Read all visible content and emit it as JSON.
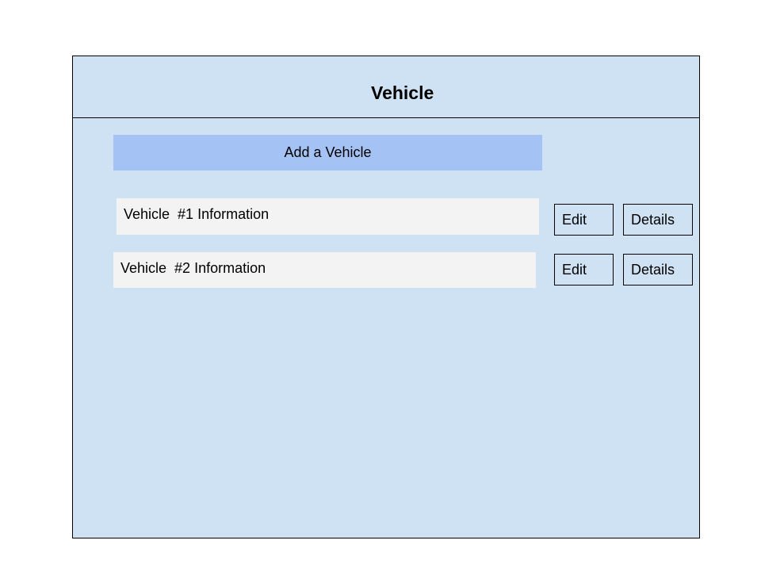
{
  "page": {
    "title": "Vehicle",
    "add_button_label": "Add a Vehicle"
  },
  "vehicles": [
    {
      "info": "Vehicle  #1 Information",
      "edit_label": "Edit",
      "details_label": "Details"
    },
    {
      "info": "Vehicle  #2 Information",
      "edit_label": "Edit",
      "details_label": "Details"
    }
  ],
  "colors": {
    "panel_background": "#cfe2f3",
    "add_button": "#a4c2f4",
    "info_row": "#f3f3f3",
    "border": "#000000"
  }
}
